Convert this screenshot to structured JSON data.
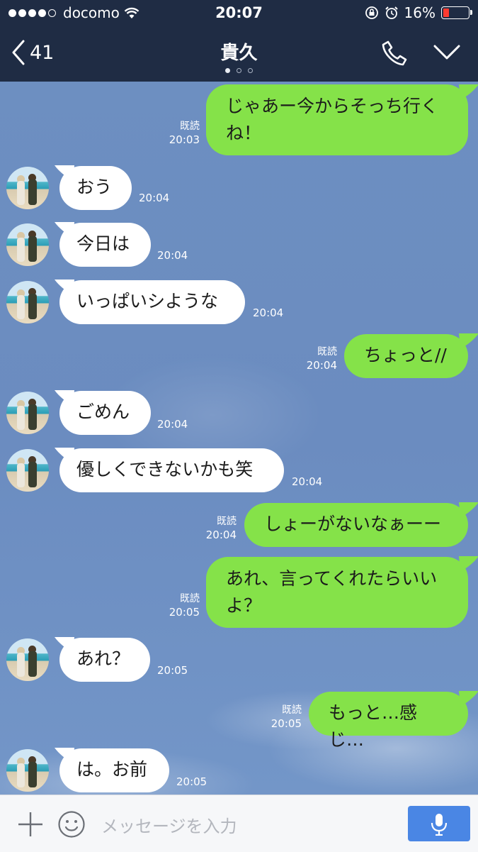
{
  "status_bar": {
    "carrier": "docomo",
    "time": "20:07",
    "battery": "16%",
    "battery_color": "#ff3b30"
  },
  "header": {
    "back_count": "41",
    "title": "貴久",
    "icons": [
      "back-chevron-icon",
      "phone-icon",
      "chevron-down-icon"
    ]
  },
  "messages": [
    {
      "side": "out",
      "lines": [
        "じゃあー今からそっち行く",
        "ね！"
      ],
      "read": "既読",
      "time": "20:03"
    },
    {
      "side": "in",
      "text": "おう",
      "time": "20:04"
    },
    {
      "side": "in",
      "text": "今日は",
      "time": "20:04"
    },
    {
      "side": "in",
      "text": "いっぱいシような",
      "time": "20:04"
    },
    {
      "side": "out",
      "text": "ちょっと//",
      "read": "既読",
      "time": "20:04"
    },
    {
      "side": "in",
      "text": "ごめん",
      "time": "20:04"
    },
    {
      "side": "in",
      "text": "優しくできないかも笑",
      "time": "20:04"
    },
    {
      "side": "out",
      "text": "しょーがないなぁーー",
      "read": "既読",
      "time": "20:04"
    },
    {
      "side": "out",
      "lines": [
        "あれ、言ってくれたらいい",
        "よ？"
      ],
      "read": "既読",
      "time": "20:05"
    },
    {
      "side": "in",
      "text": "あれ？",
      "time": "20:05"
    },
    {
      "side": "out",
      "text": "もっと…感じ…",
      "read": "既読",
      "time": "20:05"
    },
    {
      "side": "in",
      "text": "は。お前",
      "time": "20:05"
    }
  ],
  "input_bar": {
    "placeholder": "メッセージを入力",
    "mic_color": "#4a86e4"
  },
  "colors": {
    "header_bg": "#1f2c44",
    "outgoing_bubble": "#85e249",
    "incoming_bubble": "#ffffff",
    "chat_bg": "#6d8fc1"
  }
}
